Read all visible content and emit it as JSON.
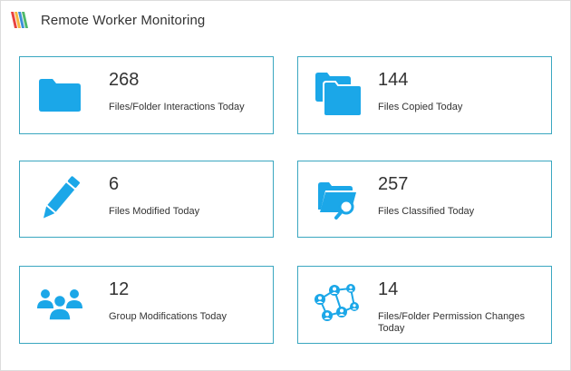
{
  "header": {
    "title": "Remote Worker Monitoring",
    "logo_icon": "striped-logo-icon"
  },
  "colors": {
    "accent": "#1ba7e8",
    "border": "#3aa7c0"
  },
  "cards": [
    {
      "value": "268",
      "label": "Files/Folder Interactions Today",
      "icon": "folder-icon"
    },
    {
      "value": "144",
      "label": "Files Copied Today",
      "icon": "folders-copy-icon"
    },
    {
      "value": "6",
      "label": "Files Modified Today",
      "icon": "pencil-icon"
    },
    {
      "value": "257",
      "label": "Files Classified Today",
      "icon": "folder-search-icon"
    },
    {
      "value": "12",
      "label": "Group Modifications Today",
      "icon": "users-group-icon"
    },
    {
      "value": "14",
      "label": "Files/Folder Permission Changes Today",
      "icon": "network-users-icon"
    }
  ]
}
